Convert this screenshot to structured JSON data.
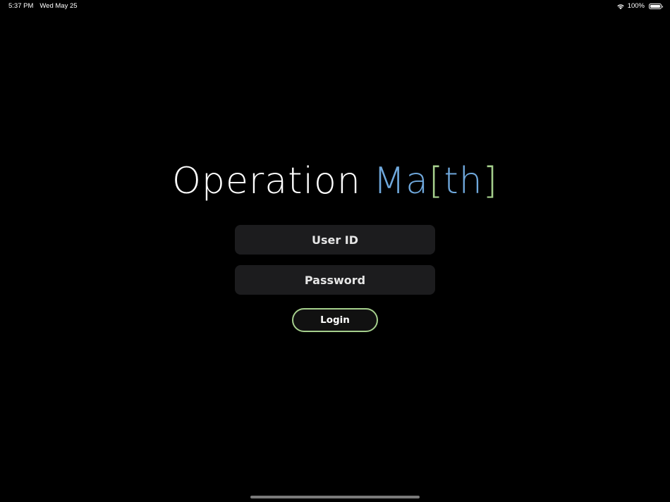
{
  "status_bar": {
    "time": "5:37 PM",
    "date": "Wed May 25",
    "battery": "100%",
    "battery_level": 1.0
  },
  "app": {
    "title_part1": "Operation ",
    "title_part2": "Ma",
    "title_bracket_open": "[",
    "title_part3": "th",
    "title_bracket_close": "]",
    "colors": {
      "title_white": "#ffffff",
      "title_blue": "#6fa8dc",
      "accent_green": "#a5cf8c",
      "field_bg": "#1c1c1e"
    }
  },
  "login_form": {
    "user_id_placeholder": "User ID",
    "user_id_value": "",
    "password_placeholder": "Password",
    "password_value": "",
    "login_label": "Login"
  }
}
